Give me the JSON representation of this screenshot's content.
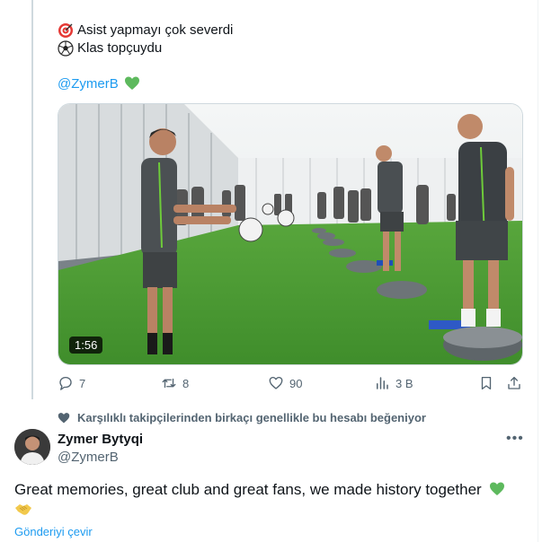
{
  "quoted_tweet": {
    "lines": [
      {
        "icon": "target-icon",
        "text": "Asist yapmayı çok severdi"
      },
      {
        "icon": "soccer-ball-icon",
        "text": "Klas topçuydu"
      }
    ],
    "mention": "@ZymerB",
    "mention_emoji": "green-heart-icon",
    "video": {
      "duration": "1:56"
    },
    "actions": {
      "replies": "7",
      "retweets": "8",
      "likes": "90",
      "views": "3 B"
    }
  },
  "social_context": "Karşılıklı takipçilerinden birkaçı genellikle bu hesabı beğeniyor",
  "reply": {
    "display_name": "Zymer Bytyqi",
    "handle": "@ZymerB",
    "text": "Great memories, great club and great fans, we made history together",
    "emojis": [
      "green-heart-icon",
      "handshake-icon"
    ],
    "translate": "Gönderiyi çevir"
  },
  "colors": {
    "accent": "#1d9bf0",
    "green_heart": "#5db95d",
    "muted": "#536471"
  }
}
